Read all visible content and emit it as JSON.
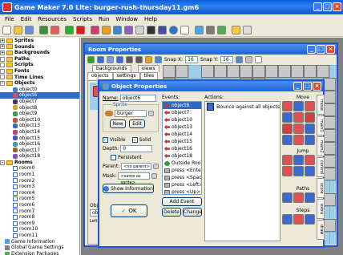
{
  "app": {
    "title": "Game Maker 7.0 Lite: burger-rush-thursday11.gm6"
  },
  "menu": [
    "File",
    "Edit",
    "Resources",
    "Scripts",
    "Run",
    "Window",
    "Help"
  ],
  "tree": {
    "folders_top": [
      {
        "label": "Sprites",
        "state": "+"
      },
      {
        "label": "Sounds",
        "state": "+"
      },
      {
        "label": "Backgrounds",
        "state": "+"
      },
      {
        "label": "Paths",
        "state": ""
      },
      {
        "label": "Scripts",
        "state": ""
      },
      {
        "label": "Fonts",
        "state": ""
      },
      {
        "label": "Time Lines",
        "state": ""
      },
      {
        "label": "Objects",
        "state": "-"
      }
    ],
    "objects": [
      "object0",
      "object6",
      "object7",
      "object8",
      "object9",
      "object10",
      "object13",
      "object14",
      "object15",
      "object16",
      "object17",
      "object18"
    ],
    "rooms_label": "Rooms",
    "rooms": [
      "room0",
      "room1",
      "room2",
      "room3",
      "room4",
      "room5",
      "room6",
      "room7",
      "room8",
      "room9",
      "room10",
      "room11"
    ],
    "extras": [
      "Game Information",
      "Global Game Settings",
      "Extension Packages"
    ]
  },
  "room_window": {
    "title": "Room Properties",
    "snap_x_label": "Snap X:",
    "snap_x": "16",
    "snap_y_label": "Snap Y:",
    "snap_y": "16",
    "tabs_top": [
      "backgrounds",
      "views"
    ],
    "tabs_bottom": [
      "objects",
      "settings",
      "tiles"
    ]
  },
  "object_window": {
    "title": "Object Properties",
    "name_label": "Name:",
    "name_value": "object6",
    "sprite_label": "Sprite",
    "sprite_value": "burger",
    "new_label": "New",
    "edit_label": "Edit",
    "visible_label": "Visible",
    "solid_label": "Solid",
    "depth_label": "Depth:",
    "depth_value": "0",
    "persistent_label": "Persistent",
    "parent_label": "Parent:",
    "parent_value": "<no parent>",
    "mask_label": "Mask:",
    "mask_value": "<same as sprite>",
    "show_info_label": "Show Information",
    "ok_label": "OK",
    "events_label": "Events:",
    "events": [
      "object6",
      "object7",
      "object10",
      "object13",
      "object14",
      "object15",
      "object16",
      "object18",
      "Outside Room",
      "press <Enter>",
      "press <Space>",
      "press <Left>",
      "press <Up>"
    ],
    "actions_label": "Actions:",
    "actions": [
      "Bounce against all objects"
    ],
    "add_event_label": "Add Event",
    "delete_label": "Delete",
    "change_label": "Change",
    "move_label": "Move",
    "jump_label": "Jump",
    "paths_label": "Paths",
    "steps_label": "Steps",
    "vtabs": [
      "move",
      "main1",
      "main2",
      "control",
      "score",
      "extra",
      "draw"
    ]
  },
  "obj_partial": {
    "label": "Object",
    "field": "object",
    "left_label": "Left m"
  },
  "colors": {
    "accent": "#1c54d4",
    "selection": "#316ac5",
    "grid": "#9fcfe6"
  }
}
